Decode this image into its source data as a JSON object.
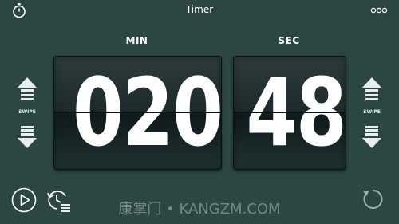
{
  "header": {
    "title": "Timer"
  },
  "timer": {
    "min_label": "MIN",
    "sec_label": "SEC",
    "minutes": "020",
    "seconds": "48"
  },
  "controls": {
    "swipe_left": "SWIPE",
    "swipe_right": "SWIPE"
  },
  "icons": {
    "stopwatch": "stopwatch-icon",
    "more": "more-icon",
    "play": "play-icon",
    "timer_list": "timer-list-icon",
    "reset": "reset-icon"
  },
  "watermark": "康掌门 • KANGZM.COM"
}
